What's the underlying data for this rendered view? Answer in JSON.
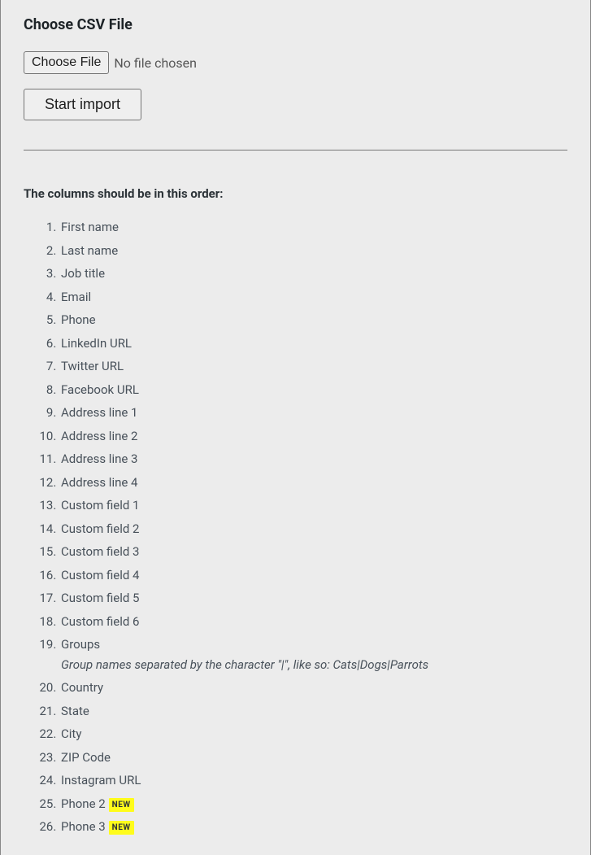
{
  "section_title": "Choose CSV File",
  "file_input": {
    "button_label": "Choose File",
    "status_text": "No file chosen"
  },
  "start_import_label": "Start import",
  "order_label": "The columns should be in this order:",
  "badge_new_text": "NEW",
  "columns": [
    {
      "label": "First name"
    },
    {
      "label": "Last name"
    },
    {
      "label": "Job title"
    },
    {
      "label": "Email"
    },
    {
      "label": "Phone"
    },
    {
      "label": "LinkedIn URL"
    },
    {
      "label": "Twitter URL"
    },
    {
      "label": "Facebook URL"
    },
    {
      "label": "Address line 1"
    },
    {
      "label": "Address line 2"
    },
    {
      "label": "Address line 3"
    },
    {
      "label": "Address line 4"
    },
    {
      "label": "Custom field 1"
    },
    {
      "label": "Custom field 2"
    },
    {
      "label": "Custom field 3"
    },
    {
      "label": "Custom field 4"
    },
    {
      "label": "Custom field 5"
    },
    {
      "label": "Custom field 6"
    },
    {
      "label": "Groups",
      "note": "Group names separated by the character \"|\", like so: Cats|Dogs|Parrots"
    },
    {
      "label": "Country"
    },
    {
      "label": "State"
    },
    {
      "label": "City"
    },
    {
      "label": "ZIP Code"
    },
    {
      "label": "Instagram URL"
    },
    {
      "label": "Phone 2",
      "badge": "new"
    },
    {
      "label": "Phone 3",
      "badge": "new"
    }
  ]
}
